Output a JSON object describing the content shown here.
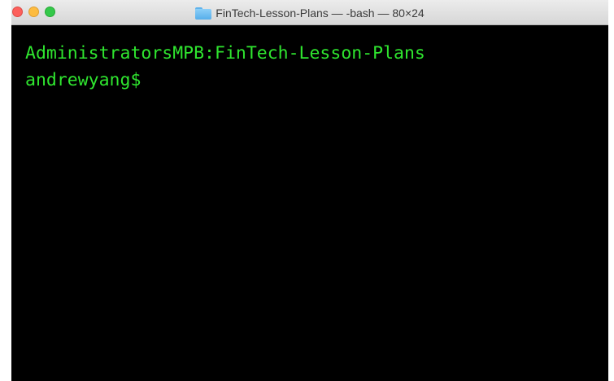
{
  "window": {
    "title": "FinTech-Lesson-Plans — -bash — 80×24",
    "folder_icon": "folder-icon"
  },
  "traffic_lights": {
    "close_color": "#fc605c",
    "minimize_color": "#fdbc40",
    "zoom_color": "#34c84a"
  },
  "terminal": {
    "background": "#000000",
    "text_color": "#2fe52f",
    "lines": [
      "AdministratorsMPB:FinTech-Lesson-Plans",
      "andrewyang$"
    ]
  }
}
